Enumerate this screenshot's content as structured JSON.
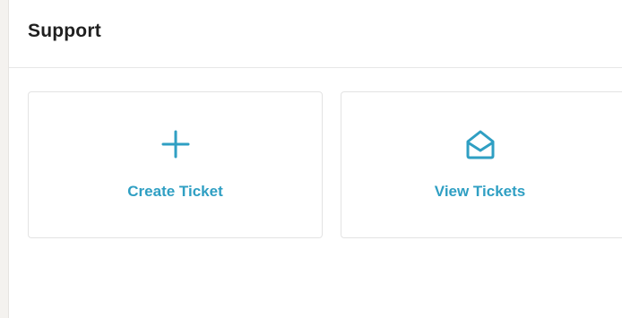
{
  "header": {
    "title": "Support"
  },
  "actions": [
    {
      "label": "Create Ticket",
      "icon": "plus-icon"
    },
    {
      "label": "View Tickets",
      "icon": "envelope-open-icon"
    }
  ],
  "colors": {
    "accent": "#2f9fc3",
    "title": "#1f1f1f",
    "border": "#e3e3e3",
    "sidebar": "#f4f2ef"
  }
}
